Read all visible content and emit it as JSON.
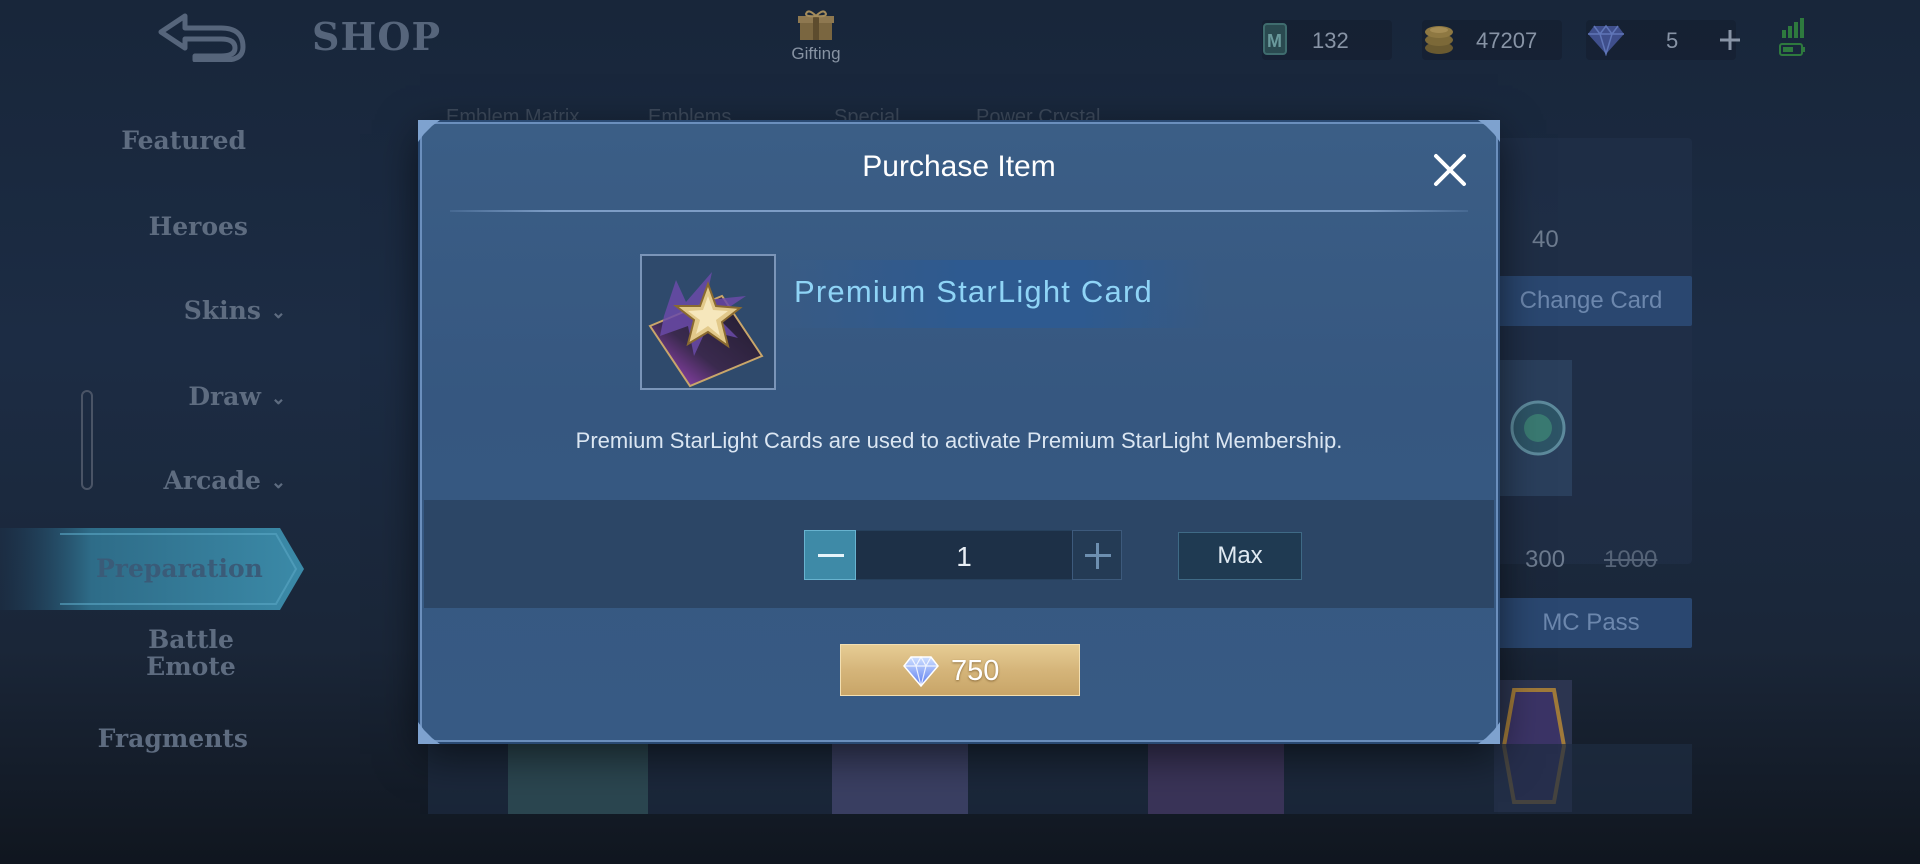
{
  "header": {
    "title": "SHOP",
    "gifting_label": "Gifting",
    "currencies": [
      {
        "icon": "mlbb-token-icon",
        "value": "132"
      },
      {
        "icon": "battle-points-icon",
        "value": "47207"
      },
      {
        "icon": "diamond-icon",
        "value": "5"
      }
    ]
  },
  "sidebar": {
    "items": [
      {
        "label": "Featured"
      },
      {
        "label": "Heroes"
      },
      {
        "label": "Skins"
      },
      {
        "label": "Draw"
      },
      {
        "label": "Arcade"
      },
      {
        "label": "Preparation",
        "active": true
      },
      {
        "label": "Battle Emote"
      },
      {
        "label": "Fragments"
      }
    ]
  },
  "background": {
    "subtabs": [
      "Emblem Matrix",
      "Emblems",
      "Special",
      "Power Crystal"
    ],
    "cards": [
      {
        "value": "40",
        "button": "Change Card"
      },
      {
        "value": "300",
        "old_value": "1000",
        "button": "MC Pass"
      }
    ]
  },
  "modal": {
    "title": "Purchase Item",
    "item_name": "Premium StarLight Card",
    "item_description": "Premium StarLight Cards are used to activate Premium StarLight Membership.",
    "quantity": "1",
    "max_label": "Max",
    "price": "750"
  },
  "colors": {
    "modal_bg": "#375a84",
    "item_name": "#8fd4f6",
    "buy_button": "#d5b57a",
    "minus_button": "#3e8aa7"
  }
}
